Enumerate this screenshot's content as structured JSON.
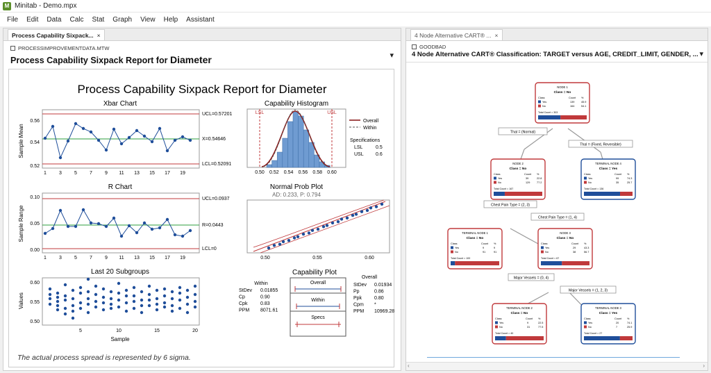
{
  "window": {
    "title": "Minitab - Demo.mpx"
  },
  "menu": [
    "File",
    "Edit",
    "Data",
    "Calc",
    "Stat",
    "Graph",
    "View",
    "Help",
    "Assistant"
  ],
  "left_pane": {
    "tab_label": "Process Capability Sixpack...",
    "tab_close": "×",
    "worksheet": "PROCESSIMPROVEMENTDATA.MTW",
    "report_title_prefix": "Process Capability Sixpack Report for ",
    "report_title_var": "Diameter",
    "dropdown_icon": "▾"
  },
  "sixpack": {
    "main_title": "Process Capability Sixpack Report for Diameter",
    "xbar": {
      "title": "Xbar Chart",
      "ylabel": "Sample Mean",
      "ucl": "UCL=0.57201",
      "center": "X=0.54646",
      "lcl": "LCL=0.52091",
      "yticks": [
        "0.56",
        "0.54",
        "0.52"
      ],
      "xticks": [
        "1",
        "3",
        "5",
        "7",
        "9",
        "11",
        "13",
        "15",
        "17",
        "19"
      ]
    },
    "r": {
      "title": "R Chart",
      "ylabel": "Sample Range",
      "ucl": "UCL=0.0937",
      "center": "R=0.0443",
      "lcl": "LCL=0",
      "yticks": [
        "0.10",
        "0.05",
        "0.00"
      ],
      "xticks": [
        "1",
        "3",
        "5",
        "7",
        "9",
        "11",
        "13",
        "15",
        "17",
        "19"
      ]
    },
    "last20": {
      "title": "Last 20 Subgroups",
      "ylabel": "Values",
      "xlabel": "Sample",
      "yticks": [
        "0.60",
        "0.55",
        "0.50"
      ],
      "xticks": [
        "5",
        "10",
        "15",
        "20"
      ]
    },
    "hist": {
      "title": "Capability Histogram",
      "lsl": "LSL",
      "usl": "USL",
      "xticks": [
        "0.50",
        "0.52",
        "0.54",
        "0.56",
        "0.58",
        "0.60"
      ],
      "legend_overall": "Overall",
      "legend_within": "Within",
      "spec_title": "Specifications",
      "spec_lsl_label": "LSL",
      "spec_lsl": "0.5",
      "spec_usl_label": "USL",
      "spec_usl": "0.6"
    },
    "normprob": {
      "title": "Normal Prob Plot",
      "subtitle": "AD: 0.233, P: 0.794",
      "xticks": [
        "0.50",
        "0.55",
        "0.60"
      ]
    },
    "capplot": {
      "title": "Capability Plot",
      "within_head": "Within",
      "overall_head": "Overall",
      "within_rows": [
        [
          "StDev",
          "0.01855"
        ],
        [
          "Cp",
          "0.90"
        ],
        [
          "Cpk",
          "0.83"
        ],
        [
          "PPM",
          "8071.61"
        ]
      ],
      "overall_rows": [
        [
          "StDev",
          "0.01934"
        ],
        [
          "Pp",
          "0.86"
        ],
        [
          "Ppk",
          "0.80"
        ],
        [
          "Cpm",
          "*"
        ],
        [
          "PPM",
          "10969.28"
        ]
      ],
      "box_overall": "Overall",
      "box_within": "Within",
      "box_specs": "Specs"
    },
    "footer": "The actual process spread is represented by 6 sigma."
  },
  "right_pane": {
    "tab_label": "4 Node Alternative CART® ...",
    "tab_close": "×",
    "worksheet": "GOODBAD",
    "title": "4 Node Alternative CART® Classification: TARGET versus AGE, CREDIT_LIMIT, GENDER, ...",
    "dropdown_icon": "▾"
  },
  "tree": {
    "nodes": [
      {
        "id": "n1",
        "title": "NODE 1",
        "cls": "Class = No",
        "kind": "no",
        "rows": [
          [
            "Yes",
            "139",
            "45.9"
          ],
          [
            "No",
            "164",
            "54.1"
          ]
        ],
        "total": "Total Count = 303"
      },
      {
        "id": "n2",
        "title": "NODE 2",
        "cls": "Class = No",
        "kind": "no",
        "rows": [
          [
            "Yes",
            "39",
            "22.8"
          ],
          [
            "No",
            "129",
            "77.2"
          ]
        ],
        "total": "Total Count = 167"
      },
      {
        "id": "n4",
        "title": "TERMINAL NODE 4",
        "cls": "Class = Yes",
        "kind": "yes",
        "rows": [
          [
            "Yes",
            "99",
            "74.3"
          ],
          [
            "No",
            "35",
            "25.7"
          ]
        ],
        "total": "Total Count = 136"
      },
      {
        "id": "n1t",
        "title": "TERMINAL NODE 1",
        "cls": "Class = No",
        "kind": "no",
        "rows": [
          [
            "Yes",
            "9",
            "9"
          ],
          [
            "No",
            "91",
            "91"
          ]
        ],
        "total": "Total Count = 100"
      },
      {
        "id": "n3",
        "title": "NODE 3",
        "cls": "Class = No",
        "kind": "no",
        "rows": [
          [
            "Yes",
            "29",
            "43.3"
          ],
          [
            "No",
            "38",
            "56.7"
          ]
        ],
        "total": "Total Count = 67"
      },
      {
        "id": "n2t",
        "title": "TERMINAL NODE 2",
        "cls": "Class = No",
        "kind": "no",
        "rows": [
          [
            "Yes",
            "9",
            "22.5"
          ],
          [
            "No",
            "31",
            "77.5"
          ]
        ],
        "total": "Total Count = 40"
      },
      {
        "id": "n3t",
        "title": "TERMINAL NODE 3",
        "cls": "Class = Yes",
        "kind": "yes",
        "rows": [
          [
            "Yes",
            "20",
            "74.1"
          ],
          [
            "No",
            "7",
            "25.9"
          ]
        ],
        "total": "Total Count = 27"
      }
    ],
    "splits": [
      "Thal = (Normal)",
      "Thal = (Fixed, Reversible)",
      "Chest Pain Type = (2, 3)",
      "Chest Pain Type = (1, 4)",
      "Major Vessels = (0, 4)",
      "Major Vessels = (1, 2, 3)"
    ],
    "col_headers": [
      "Class",
      "Count",
      "%"
    ]
  },
  "colors": {
    "red": "#c0393b",
    "blue": "#1f4e9a",
    "green": "#2e9e3e",
    "bar": "#6f9bd1"
  }
}
